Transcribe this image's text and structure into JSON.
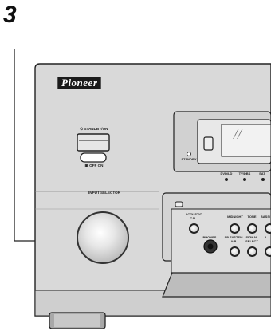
{
  "step_number": "3",
  "brand": "Pioneer",
  "standby_on_label": "STANDBY/ON",
  "power_switch_label": "OFF  ON",
  "standby_indicator_label": "STANDBY",
  "input_selector_label": "INPUT SELECTOR",
  "display_digits": "//",
  "source_buttons": [
    "DVD/LD",
    "TV/DBS",
    "SAT"
  ],
  "panel_buttons_top": [
    "ACOUSTIC CAL.",
    "MIDNIGHT",
    "TONE",
    "BASS/"
  ],
  "panel_buttons_bottom": [
    "PHONES",
    "SP SYSTEM A/B",
    "SIGNAL SELECT",
    "L"
  ],
  "icons": {
    "power": "power-icon",
    "switch": "power-switch-icon"
  },
  "colors": {
    "chassis": "#d8d8d8",
    "outline": "#222222"
  }
}
